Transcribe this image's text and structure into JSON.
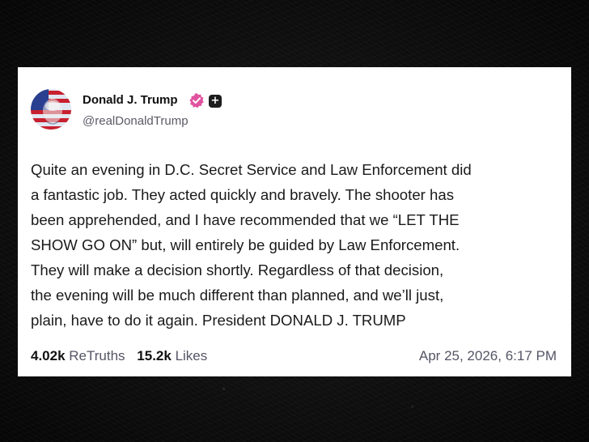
{
  "post": {
    "author": {
      "name": "Donald J. Trump",
      "handle": "@realDonaldTrump",
      "verified_color": "#e0539e"
    },
    "body_lines": [
      "Quite an evening in D.C. Secret Service and Law Enforcement did",
      "a fantastic job. They acted quickly and bravely. The shooter has",
      "been apprehended, and I have recommended that we “LET THE",
      "SHOW GO ON” but, will entirely be guided by Law Enforcement.",
      "They will make a decision shortly. Regardless of that decision,",
      "the evening will be much different than planned, and we’ll just,",
      "plain, have to do it again. President DONALD J. TRUMP"
    ],
    "retruths": {
      "count": "4.02k",
      "label": "ReTruths"
    },
    "likes": {
      "count": "15.2k",
      "label": "Likes"
    },
    "timestamp": "Apr 25, 2026, 6:17 PM"
  },
  "icons": {
    "verified": "verified-badge-icon",
    "plus": "plus-badge-icon"
  }
}
